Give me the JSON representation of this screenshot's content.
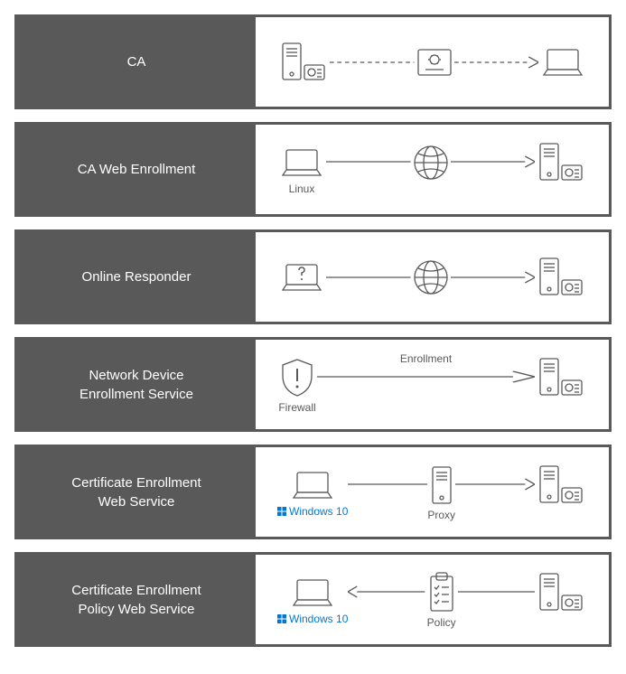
{
  "rows": [
    {
      "label": "CA"
    },
    {
      "label": "CA Web Enrollment",
      "cap1": "Linux"
    },
    {
      "label": "Online Responder"
    },
    {
      "label": "Network Device\nEnrollment Service",
      "cap1": "Firewall",
      "lineLabel": "Enrollment"
    },
    {
      "label": "Certificate Enrollment\nWeb Service",
      "cap1": "Windows 10",
      "cap2": "Proxy"
    },
    {
      "label": "Certificate Enrollment\nPolicy Web Service",
      "cap1": "Windows 10",
      "cap2": "Policy"
    }
  ]
}
